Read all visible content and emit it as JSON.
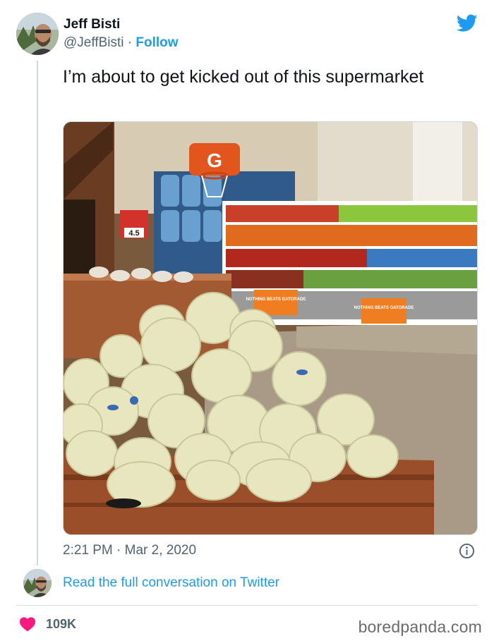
{
  "author": {
    "name": "Jeff Bisti",
    "handle": "@JeffBisti",
    "separator": "·",
    "follow_label": "Follow"
  },
  "tweet": {
    "text": "I’m about to get kicked out of this supermarket",
    "time": "2:21 PM",
    "date_separator": "·",
    "date": "Mar 2, 2020"
  },
  "photo": {
    "hoop_letter": "G",
    "price_tag": "4.5",
    "sign_left": "NOTHING BEATS GATORADE",
    "sign_right": "NOTHING BEATS GATORADE"
  },
  "conversation": {
    "link_label": "Read the full conversation on Twitter"
  },
  "engagement": {
    "likes": "109K"
  },
  "watermark": "boredpanda.com",
  "icons": {
    "brand": "twitter-bird-icon",
    "info": "info-icon",
    "like": "heart-icon"
  },
  "colors": {
    "link": "#1d9bf0",
    "heart": "#f91880",
    "text": "#0f1419",
    "muted": "#536471"
  }
}
